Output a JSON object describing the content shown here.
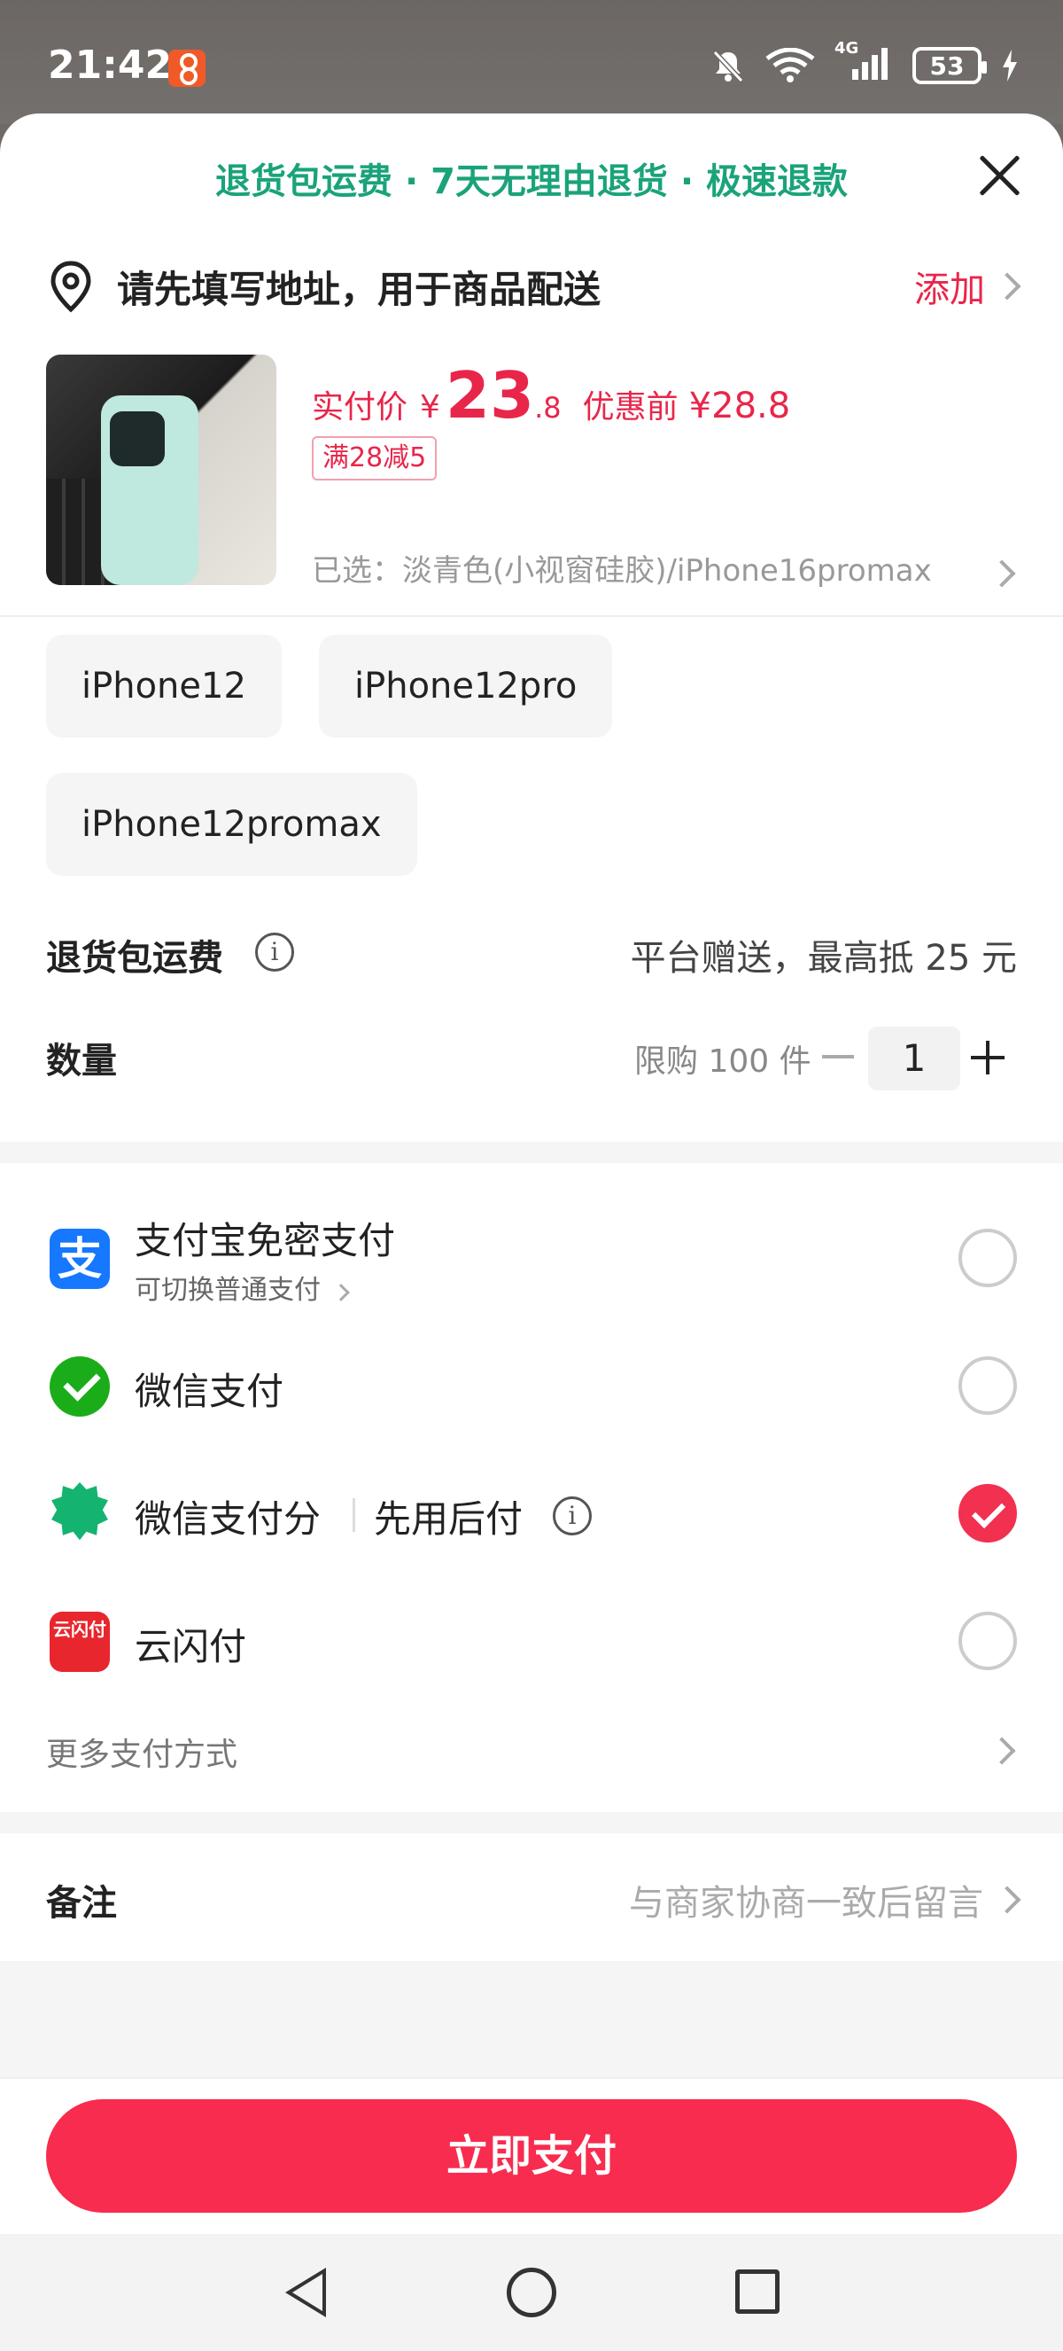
{
  "status_bar": {
    "time": "21:42",
    "battery": "53",
    "network": "4G",
    "icons": [
      "app-notification-icon",
      "bell-off-icon",
      "wifi-icon",
      "signal-icon",
      "battery-icon",
      "charging-icon"
    ]
  },
  "sheet": {
    "banner": "退货包运费 · 7天无理由退货 · 极速退款",
    "address": {
      "text": "请先填写地址，用于商品配送",
      "action": "添加"
    },
    "product": {
      "price_label": "实付价",
      "currency": "¥",
      "price_integer": "23",
      "price_decimal": ".8",
      "original_label": "优惠前",
      "original_price": "¥28.8",
      "coupon": "满28减5",
      "selected": "已选：淡青色(小视窗硅胶)/iPhone16promax"
    },
    "spec_options": [
      "iPhone12",
      "iPhone12pro",
      "iPhone12promax"
    ],
    "return_shipping": {
      "label": "退货包运费",
      "value": "平台赠送，最高抵 25 元"
    },
    "quantity": {
      "label": "数量",
      "limit": "限购 100 件",
      "value": "1"
    },
    "payment": {
      "methods": [
        {
          "name": "支付宝免密支付",
          "sub": "可切换普通支付",
          "checked": false
        },
        {
          "name": "微信支付",
          "checked": false
        },
        {
          "name": "微信支付分",
          "tag": "先用后付",
          "checked": true
        },
        {
          "name": "云闪付",
          "checked": false
        }
      ],
      "more": "更多支付方式"
    },
    "note": {
      "label": "备注",
      "placeholder": "与商家协商一致后留言"
    },
    "pay_button": "立即支付"
  },
  "colors": {
    "accent_red": "#f72c4e",
    "banner_green": "#1aa37a",
    "alipay_blue": "#1677ff",
    "wechat_green": "#1aad19"
  }
}
